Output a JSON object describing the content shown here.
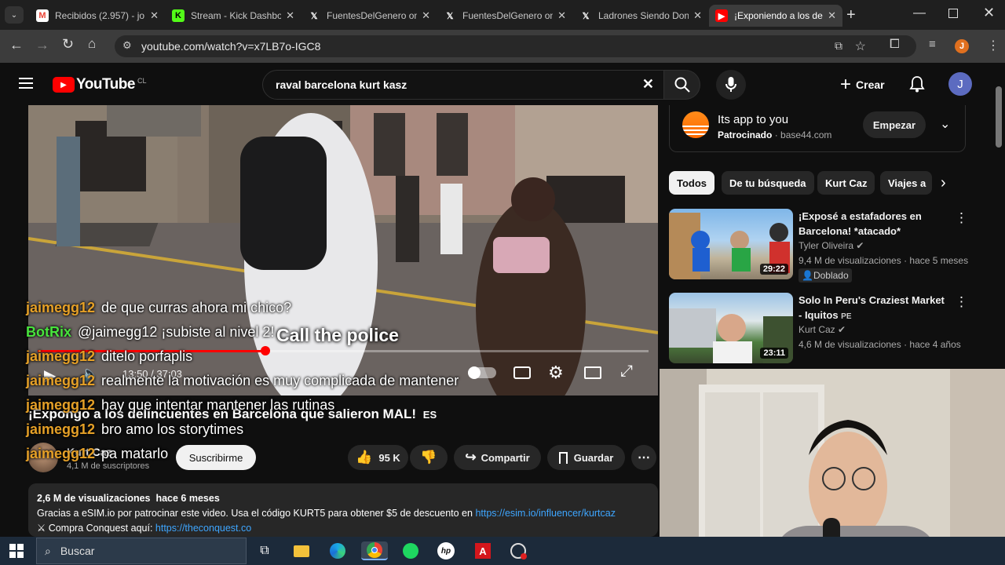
{
  "browser": {
    "tabs": [
      {
        "title": "Recibidos (2.957) - jo",
        "icon": "gmail-icon",
        "color": "#ea4335",
        "glyph": "M"
      },
      {
        "title": "Stream - Kick Dashbo",
        "icon": "kick-icon",
        "color": "#53fc18",
        "glyph": "K"
      },
      {
        "title": "FuentesDelGenero on",
        "icon": "x-icon",
        "color": "#000000",
        "glyph": "𝕏"
      },
      {
        "title": "FuentesDelGenero on",
        "icon": "x-icon",
        "color": "#000000",
        "glyph": "𝕏"
      },
      {
        "title": "Ladrones Siendo Don",
        "icon": "x-icon",
        "color": "#000000",
        "glyph": "𝕏"
      },
      {
        "title": "¡Exponiendo a los del",
        "icon": "youtube-icon",
        "color": "#ff0000",
        "glyph": "▶"
      }
    ],
    "url": "youtube.com/watch?v=x7LB7o-IGC8",
    "profile_initial": "J"
  },
  "youtube": {
    "logo_text": "YouTube",
    "region": "CL",
    "search_value": "raval barcelona kurt kasz",
    "create_label": "Crear",
    "avatar_initial": "J"
  },
  "player": {
    "subtitle": "Call the police",
    "time": "13:50 / 37:03",
    "progress": 0.373
  },
  "video": {
    "title": "¡Expongo a los delincuentes en Barcelona que salieron MAL!",
    "title_badge": "ES",
    "channel": "Kurt Caz",
    "subscribers": "4,1 M de suscriptores",
    "subscribe_label": "Suscribirme",
    "likes": "95 K",
    "share_label": "Compartir",
    "save_label": "Guardar",
    "views": "2,6 M de visualizaciones",
    "age": "hace 6 meses",
    "desc_line1": "Gracias a eSIM.io por patrocinar este video. Usa el código KURT5 para obtener $5 de descuento en",
    "desc_link1": "https://esim.io/influencer/kurtcaz",
    "desc_line2_prefix": "Compra Conquest aquí:",
    "desc_link2": "https://theconquest.co"
  },
  "chat": [
    {
      "user": "jaimegg12",
      "msg": "de que curras ahora mi chico?",
      "bot": false
    },
    {
      "user": "BotRix",
      "msg": "@jaimegg12 ¡subiste al nivel 2!",
      "bot": true
    },
    {
      "user": "jaimegg12",
      "msg": "ditelo porfaplis",
      "bot": false
    },
    {
      "user": "jaimegg12",
      "msg": "realmente la motivación es muy complicada de mantener",
      "bot": false
    },
    {
      "user": "jaimegg12",
      "msg": "hay que intentar mantener las rutinas",
      "bot": false
    },
    {
      "user": "jaimegg12",
      "msg": "bro amo los storytimes",
      "bot": false
    },
    {
      "user": "jaimegg12",
      "msg": "pa matarlo",
      "bot": false
    }
  ],
  "ad": {
    "title": "Its app to you",
    "sponsored": "Patrocinado",
    "domain": "base44.com",
    "cta": "Empezar"
  },
  "chips": [
    "Todos",
    "De tu búsqueda",
    "Kurt Caz",
    "Viajes a"
  ],
  "related": [
    {
      "title": "¡Exposé a estafadores en Barcelona! *atacado*",
      "channel": "Tyler Oliveira",
      "meta": "9,4 M de visualizaciones · hace 5 meses",
      "badge": "Doblado",
      "duration": "29:22"
    },
    {
      "title": "Solo In Peru's Craziest Market - Iquitos",
      "channel": "Kurt Caz",
      "meta": "4,6 M de visualizaciones · hace 4 años",
      "badge": "PE",
      "duration": "23:11"
    }
  ],
  "taskbar": {
    "search_placeholder": "Buscar"
  }
}
